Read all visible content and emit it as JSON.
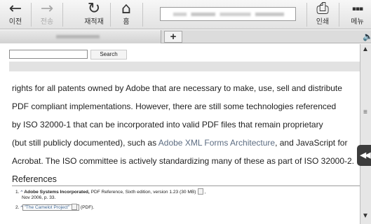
{
  "toolbar": {
    "back": {
      "icon": "←",
      "label": "이전"
    },
    "forward": {
      "icon": "→",
      "label": "전송"
    },
    "reload": {
      "icon": "↻",
      "label": "재적재"
    },
    "home": {
      "icon": "⌂",
      "label": "홈"
    },
    "print": {
      "icon": "⎙",
      "label": "인쇄"
    },
    "menu": {
      "icon": "▪▪▪",
      "label": "메뉴"
    }
  },
  "tabs": {
    "new_tab_label": "+",
    "speaker_icon": "🔈"
  },
  "search": {
    "button_label": "Search",
    "input_value": ""
  },
  "article": {
    "lines": [
      "rights for all patents owned by Adobe that are necessary to make, use, sell and distribute",
      "PDF compliant implementations. However, there are still some technologies referenced",
      "by ISO 32000-1 that can be incorporated into valid PDF files that remain proprietary"
    ],
    "line4": {
      "before": "(but still publicly documented), such as ",
      "link": "Adobe XML Forms Architecture",
      "after": ", and JavaScript for"
    },
    "line5": "Acrobat. The ISO committee is actively standardizing many of these as part of ISO 32000-2."
  },
  "references": {
    "heading": "References",
    "items": [
      {
        "num": "1.",
        "caret": "^",
        "name": "Adobe Systems Incorporated,",
        "rest": " PDF Reference, Sixth edition, version 1.23 (30 MB)",
        "cont": "Nov 2006, p. 33."
      },
      {
        "num": "2.",
        "caret": "^",
        "name": "\"The Camelot Project\"",
        "rest": " (PDF)."
      }
    ]
  },
  "scrollbar": {
    "up": "▲",
    "down": "▼",
    "grip": "≡"
  },
  "side_handle": {
    "icon": "◀◀"
  }
}
